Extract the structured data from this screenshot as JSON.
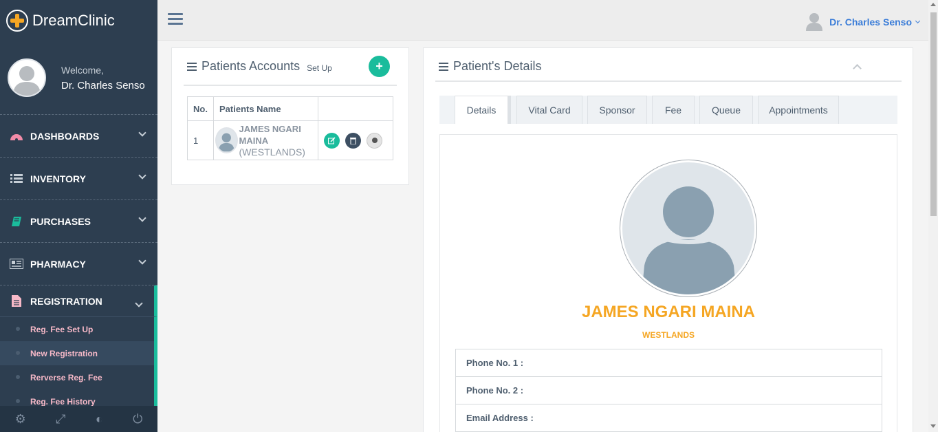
{
  "brand": {
    "name": "DreamClinic"
  },
  "profile": {
    "welcome": "Welcome,",
    "name": "Dr. Charles Senso"
  },
  "menu": {
    "dashboards": "DASHBOARDS",
    "inventory": "INVENTORY",
    "purchases": "PURCHASES",
    "pharmacy": "PHARMACY",
    "registration": "REGISTRATION"
  },
  "submenu": {
    "reg_fee_setup": "Reg. Fee Set Up",
    "new_registration": "New Registration",
    "reverse_reg_fee": "Rerverse Reg. Fee",
    "reg_fee_history": "Reg. Fee History"
  },
  "topbar": {
    "user": "Dr. Charles Senso"
  },
  "accounts_panel": {
    "title": "Patients Accounts",
    "setup": "Set Up",
    "add": "+",
    "columns": {
      "no": "No.",
      "name": "Patients Name"
    },
    "rows": [
      {
        "no": "1",
        "name": "JAMES NGARI MAINA",
        "location": "(WESTLANDS)"
      }
    ]
  },
  "details_panel": {
    "title": "Patient's Details",
    "tabs": [
      "Details",
      "Vital Card",
      "Sponsor",
      "Fee",
      "Queue",
      "Appointments"
    ],
    "patient_name": "JAMES NGARI MAINA",
    "patient_location": "WESTLANDS",
    "fields": [
      "Phone No. 1 :",
      "Phone No. 2 :",
      "Email Address :"
    ]
  },
  "colors": {
    "sidebar": "#2d3e50",
    "accent": "#1abc9c",
    "highlight": "#f5a623",
    "link": "#3b7dd8"
  }
}
